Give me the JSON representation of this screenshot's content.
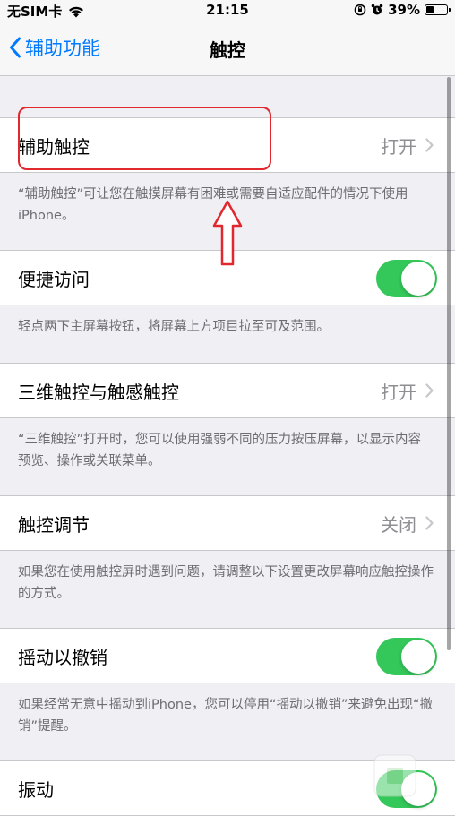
{
  "status_bar": {
    "carrier": "无SIM卡",
    "time": "21:15",
    "battery_percent": "39%",
    "battery_level": 0.39
  },
  "nav": {
    "back_label": "辅助功能",
    "title": "触控"
  },
  "sections": [
    {
      "label": "辅助触控",
      "value": "打开",
      "footer": "“辅助触控”可让您在触摸屏幕有困难或需要自适应配件的情况下使用iPhone。"
    },
    {
      "label": "便捷访问",
      "toggle_on": true,
      "footer": "轻点两下主屏幕按钮，将屏幕上方项目拉至可及范围。"
    },
    {
      "label": "三维触控与触感触控",
      "value": "打开",
      "footer": "“三维触控”打开时，您可以使用强弱不同的压力按压屏幕，以显示内容预览、操作或关联菜单。"
    },
    {
      "label": "触控调节",
      "value": "关闭",
      "footer": "如果您在使用触控屏时遇到问题，请调整以下设置更改屏幕响应触控操作的方式。"
    },
    {
      "label": "摇动以撤销",
      "toggle_on": true,
      "footer": "如果经常无意中摇动到iPhone，您可以停用“摇动以撤销”来避免出现“撤销”提醒。"
    },
    {
      "label": "振动",
      "toggle_on": true
    }
  ],
  "colors": {
    "accent": "#007aff",
    "toggle_on": "#34c759",
    "annotation": "#e0282e",
    "background": "#efeff4"
  }
}
